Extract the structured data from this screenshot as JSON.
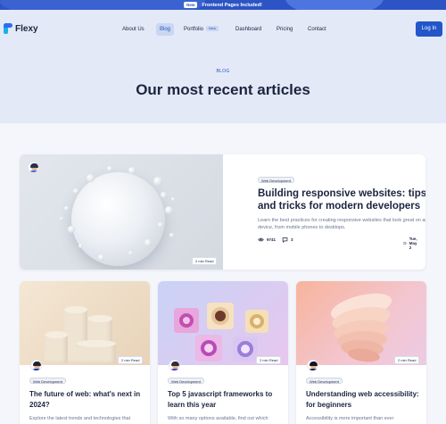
{
  "promo": {
    "badge": "New",
    "text": "Frontend Pages Included!"
  },
  "brand": {
    "name": "Flexy"
  },
  "nav": {
    "items": [
      {
        "label": "About Us"
      },
      {
        "label": "Blog"
      },
      {
        "label": "Portfolio",
        "badge": "New"
      },
      {
        "label": "Dashboard"
      },
      {
        "label": "Pricing"
      },
      {
        "label": "Contact"
      }
    ],
    "login_label": "Log In"
  },
  "hero": {
    "eyebrow": "BLOG",
    "title": "Our most recent articles"
  },
  "featured": {
    "tag": "Web Development",
    "title": "Building responsive websites: tips and tricks for modern developers",
    "description": "Learn the best practices for creating responsive websites that look great on any device, from mobile phones to desktops.",
    "views": "9741",
    "comments": "3",
    "date": "Tue, May 2",
    "read_time": "2 min Read"
  },
  "cards": [
    {
      "tag": "Web Development",
      "read_time": "2 min Read",
      "title": "The future of web: what's next in 2024?",
      "description": "Explore the latest trends and technologies that"
    },
    {
      "tag": "Web Development",
      "read_time": "2 min Read",
      "title": "Top 5 javascript frameworks to learn this year",
      "description": "With so many options available, find out which"
    },
    {
      "tag": "Web Development",
      "read_time": "2 min Read",
      "title": "Understanding web accessibility: for beginners",
      "description": "Accessibility is more important than ever"
    }
  ],
  "colors": {
    "primary": "#2356c9",
    "hero_bg": "#e3e9f6",
    "heading": "#1b2540",
    "muted": "#6b7590"
  }
}
